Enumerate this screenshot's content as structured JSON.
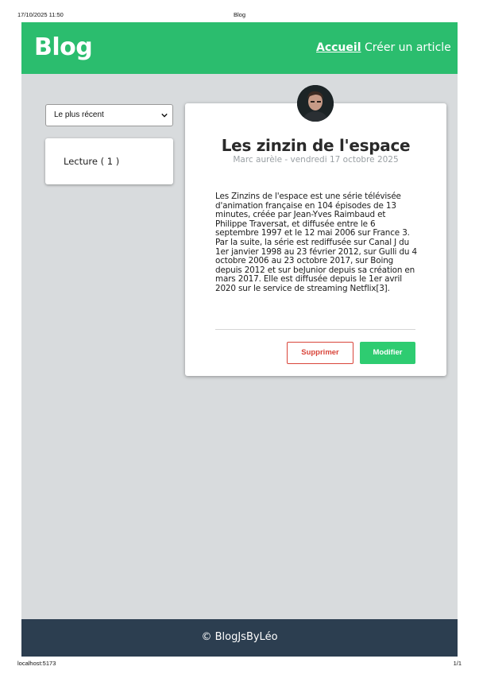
{
  "print": {
    "datetime": "17/10/2025 11:50",
    "title": "Blog",
    "url": "localhost:5173",
    "page": "1/1"
  },
  "nav": {
    "brand": "Blog",
    "links": [
      {
        "label": "Accueil",
        "active": true
      },
      {
        "label": "Créer un article",
        "active": false
      }
    ]
  },
  "sidebar": {
    "sort": {
      "selected": "Le plus récent"
    },
    "tags": [
      {
        "label": "Lecture ( 1 )"
      }
    ]
  },
  "article": {
    "title": "Les zinzin de l'espace",
    "meta": "Marc aurèle - vendredi 17 octobre 2025",
    "body": "Les Zinzins de l'espace est une série télévisée d'animation française en 104 épisodes de 13 minutes, créée par Jean-Yves Raimbaud et Philippe Traversat, et diffusée entre le 6 septembre 1997 et le 12 mai 2006 sur France 3. Par la suite, la série est rediffusée sur Canal J du 1er janvier 1998 au 23 février 2012, sur Gulli du 4 octobre 2006 au 23 octobre 2017, sur Boing depuis 2012 et sur beJunior depuis sa création en mars 2017. Elle est diffusée depuis le 1er avril 2020 sur le service de streaming Netflix[3].",
    "delete_label": "Supprimer",
    "edit_label": "Modifier"
  },
  "footer": {
    "text": "© BlogJsByLéo"
  },
  "colors": {
    "primary": "#2bbd6e",
    "danger": "#d9453a",
    "success": "#2ecc71",
    "footer": "#2c3e50",
    "background": "#d8dbdd"
  }
}
